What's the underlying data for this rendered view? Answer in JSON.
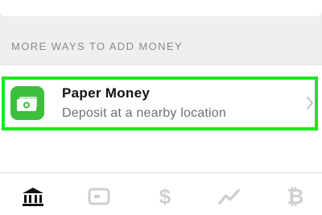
{
  "section": {
    "heading": "MORE WAYS TO ADD MONEY"
  },
  "option": {
    "title": "Paper Money",
    "subtitle": "Deposit at a nearby location",
    "icon": "cash-icon",
    "icon_color": "#3dbe3d",
    "highlight_color": "#1ee61e"
  },
  "tabbar": {
    "tabs": [
      {
        "icon": "bank-icon",
        "active": true
      },
      {
        "icon": "card-icon",
        "active": false
      },
      {
        "icon": "dollar-icon",
        "glyph": "$",
        "active": false
      },
      {
        "icon": "activity-icon",
        "active": false
      },
      {
        "icon": "bitcoin-icon",
        "glyph": "₿",
        "active": false
      }
    ]
  }
}
